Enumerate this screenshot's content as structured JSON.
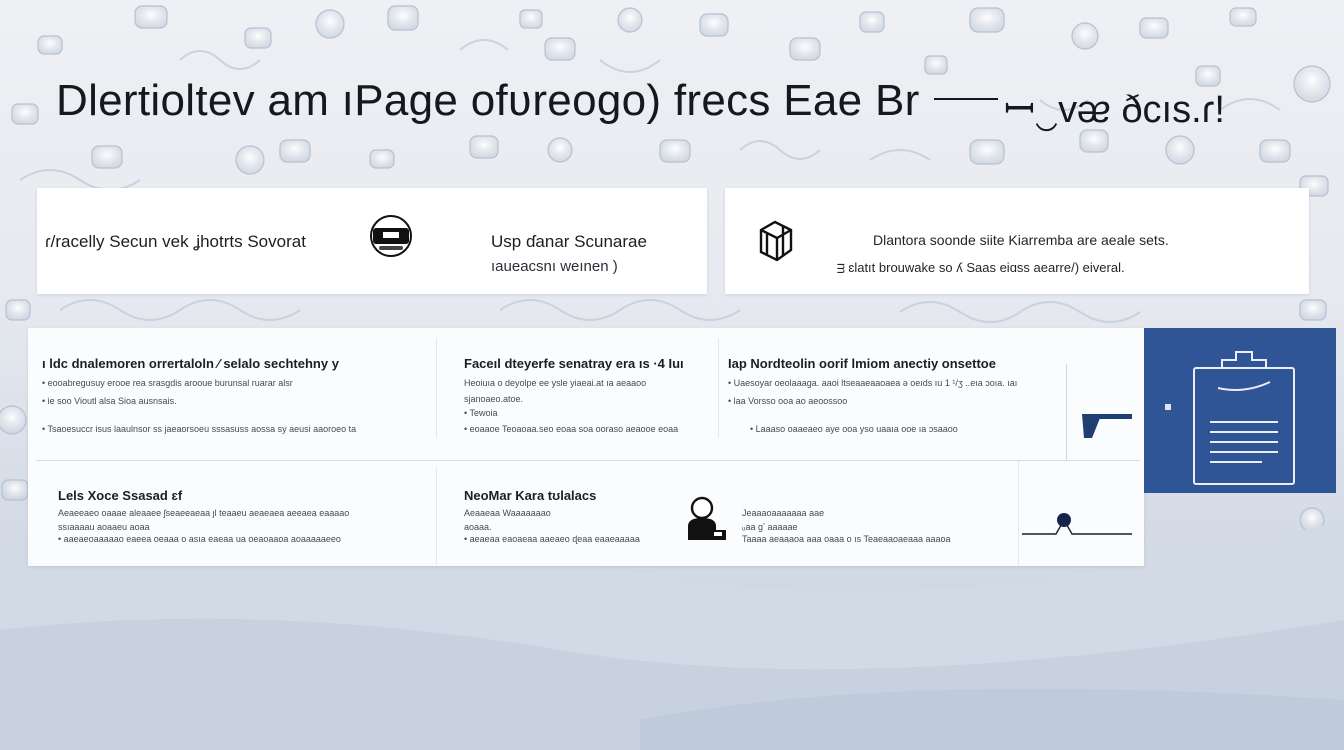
{
  "headline": {
    "text": "Dlertioltev am ıPage ofʋreogo) frecs Eae Br",
    "suffix": "ꟷ‿vᴂ ðcıs.ɾ!"
  },
  "top_cards": {
    "left": {
      "title": "ɾ/racelly Secun vek ʝhotrts Sovorat",
      "right_title": "Usp ɗanar Scunarae",
      "right_sub": "ıaueacsnı weınen )",
      "icon": "robot-mask-icon"
    },
    "right": {
      "icon": "cube-icon",
      "line1": "Dlantora soonde siite Kiarremba are aeale sets.",
      "line2": "ᴟ ɛlatıt brouwake so ʎ Saas eiɑss aearre/) eiveral."
    }
  },
  "panel": {
    "rows": [
      {
        "cols": [
          {
            "heading": "ı ldc dnalemoren orrertaloln ⁄ selalo sechtehny y",
            "lines": [
              "• eooabregusuy erooe rea srasgdis arooue burunsal ruarar alsr",
              "• ie soo Vioutl alsa Sioa ausnsais.",
              "• Tsaoesuccr isus laaulnsor ss jaeaorsoeu sssasuss aossa sy aeusi aaoroeo ta"
            ]
          },
          {
            "heading": "Faceıl dteyerfe senatray era ıs ·4 Ɩuı",
            "lines": [
              "Heoiuıa o deyolpe ee ysle yiaeai.at ıa aeaaoo",
              "sjanoaeo.atoe.",
              "• Tewoia",
              "• eoaaoe Teoaoaa.seo eoaa soa ooraso aeaooe eoaa"
            ]
          },
          {
            "heading": "Ɩap Nordteolin oorif lmiom anectiy onsettoe",
            "lines": [
              "• Uaesoyar oeolaaaga. aaoi ltseaaeaaoaea ə oeıds ıu 1 ¹/ʒ ..eıa ɔoıa. ıaı",
              "• Ɩaa Vorsso ooa ao aeoossoo",
              "• Laaaso oaaeaeo aye ooa yso uaaıa ooe ıa ɔsaaoo"
            ]
          }
        ]
      },
      {
        "cols": [
          {
            "heading": "Lels Xoce Ssasad ɛf",
            "lines": [
              "Aeaeeaeo oaaae aleaaee ʃseaeeaeaa ȷl teaaeu aeaeaea aeeaea eaaaao",
              "ssıaaaau aoaaeu aoaa",
              "• aaeaeoaaaaao eaeea oeaaa o asıa eaeaa ua oeaoaaoa aoaaaaaeeo"
            ]
          },
          {
            "heading": "NeoMar Kara tʊlalacs",
            "lines": [
              "Aeaaeaa Waaaaaaao",
              "aoaaa.",
              "• aeaeaa eaoaeaa aaeaeo ɖeaa eaaeaaaaa"
            ]
          },
          {
            "heading": "",
            "lines": [
              "Jeaaaoaaaaaaa aae",
              "ᵤaa ɡʼ aaaaae",
              "Taaaa aeaaaoa aaa oaaa o ıs Teaeaaoaeaaa aaaoa"
            ]
          }
        ]
      }
    ]
  },
  "colors": {
    "accent": "#2f5596",
    "card": "#ffffff",
    "text": "#1b1f24"
  }
}
